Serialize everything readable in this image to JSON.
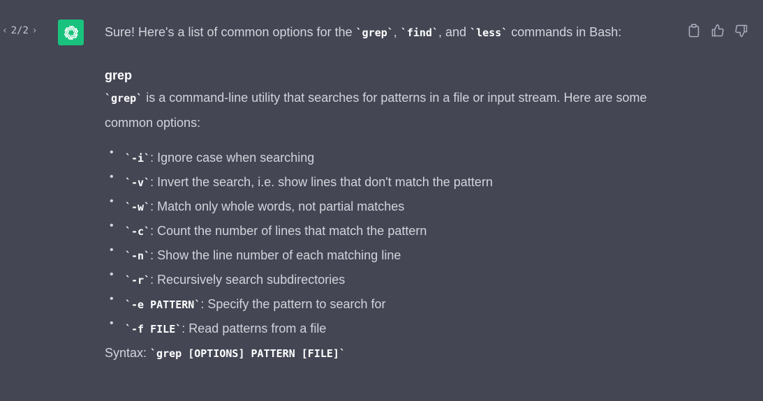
{
  "pager": {
    "current": "2/2",
    "prev_glyph": "‹",
    "next_glyph": "›"
  },
  "avatar_icon": "openai-logo-icon",
  "colors": {
    "background": "#444654",
    "avatar": "#19c37d",
    "text": "#d1d5db",
    "code": "#ffffff"
  },
  "intro": {
    "t1": "Sure! Here's a list of common options for the ",
    "c1": "`grep`",
    "t2": ", ",
    "c2": "`find`",
    "t3": ", and ",
    "c3": "`less`",
    "t4": " commands in Bash:"
  },
  "section": {
    "heading": "grep",
    "desc_code": "`grep`",
    "desc_text": " is a command-line utility that searches for patterns in a file or input stream. Here are some common options:",
    "options": [
      {
        "code": "`-i`",
        "text": ": Ignore case when searching"
      },
      {
        "code": "`-v`",
        "text": ": Invert the search, i.e. show lines that don't match the pattern"
      },
      {
        "code": "`-w`",
        "text": ": Match only whole words, not partial matches"
      },
      {
        "code": "`-c`",
        "text": ": Count the number of lines that match the pattern"
      },
      {
        "code": "`-n`",
        "text": ": Show the line number of each matching line"
      },
      {
        "code": "`-r`",
        "text": ": Recursively search subdirectories"
      },
      {
        "code": "`-e PATTERN`",
        "text": ": Specify the pattern to search for"
      },
      {
        "code": "`-f FILE`",
        "text": ": Read patterns from a file"
      }
    ],
    "syntax_label": "Syntax: ",
    "syntax_code": "`grep [OPTIONS] PATTERN [FILE]`"
  },
  "actions": [
    "clipboard-icon",
    "thumbs-up-icon",
    "thumbs-down-icon"
  ]
}
